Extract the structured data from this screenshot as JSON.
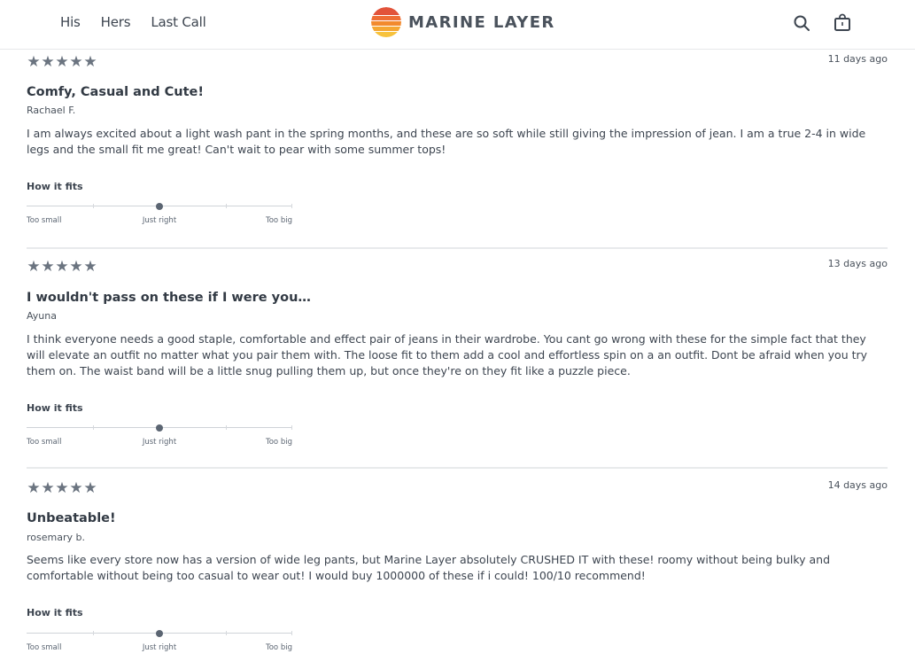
{
  "header": {
    "nav": [
      "His",
      "Hers",
      "Last Call"
    ],
    "brand": "MARINE LAYER",
    "icons": [
      "search-icon",
      "shopping-bag-icon"
    ],
    "colors": {
      "brand_orange": "#f28a2e",
      "brand_red": "#e2533a",
      "brand_yellow": "#f7c23c"
    }
  },
  "fit": {
    "heading": "How it fits",
    "min_label": "Too small",
    "mid_label": "Just right",
    "max_label": "Too big"
  },
  "reviews": [
    {
      "rating": 5,
      "date": "11 days ago",
      "title": "Comfy, Casual and Cute!",
      "author": "Rachael F.",
      "body": "I am always excited about a light wash pant in the spring months, and these are so soft while still giving the impression of jean. I am a true 2-4 in wide legs and the small fit me great! Can't wait to pear with some summer tops!",
      "fit_value": 0.5
    },
    {
      "rating": 5,
      "date": "13 days ago",
      "title": "I wouldn't pass on these if I were you…",
      "author": "Ayuna",
      "body": "I think everyone needs a good staple, comfortable and effect pair of jeans in their wardrobe. You cant go wrong with these for the simple fact that they will elevate an outfit no matter what you pair them with. The loose fit to them add a cool and effortless spin on a an outfit. Dont be afraid when you try them on. The waist band will be a little snug pulling them up, but once they're on they fit like a puzzle piece.",
      "fit_value": 0.5
    },
    {
      "rating": 5,
      "date": "14 days ago",
      "title": "Unbeatable!",
      "author": "rosemary b.",
      "body": "Seems like every store now has a version of wide leg pants, but Marine Layer absolutely CRUSHED IT with these! roomy without being bulky and comfortable without being too casual to wear out! I would buy 1000000 of these if i could! 100/10 recommend!",
      "fit_value": 0.5
    }
  ]
}
